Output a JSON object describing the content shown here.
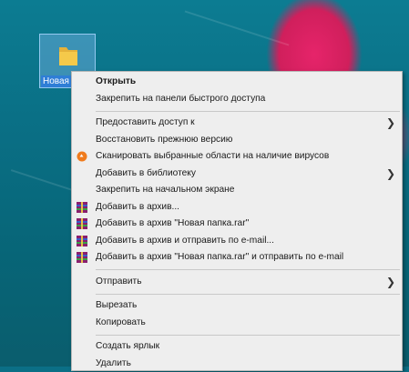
{
  "desktop": {
    "folder": {
      "label": "Новая"
    }
  },
  "context_menu": {
    "groups": [
      [
        {
          "label": "Открыть",
          "bold": true
        },
        {
          "label": "Закрепить на панели быстрого доступа"
        }
      ],
      [
        {
          "label": "Предоставить доступ к",
          "submenu": true
        },
        {
          "label": "Восстановить прежнюю версию"
        },
        {
          "label": "Сканировать выбранные области на наличие вирусов",
          "icon": "antivirus-icon"
        },
        {
          "label": "Добавить в библиотеку",
          "submenu": true
        },
        {
          "label": "Закрепить на начальном экране"
        },
        {
          "label": "Добавить в архив...",
          "icon": "winrar-icon"
        },
        {
          "label": "Добавить в архив \"Новая папка.rar\"",
          "icon": "winrar-icon"
        },
        {
          "label": "Добавить в архив и отправить по e-mail...",
          "icon": "winrar-icon"
        },
        {
          "label": "Добавить в архив \"Новая папка.rar\" и отправить по e-mail",
          "icon": "winrar-icon"
        }
      ],
      [
        {
          "label": "Отправить",
          "submenu": true
        }
      ],
      [
        {
          "label": "Вырезать"
        },
        {
          "label": "Копировать"
        }
      ],
      [
        {
          "label": "Создать ярлык"
        },
        {
          "label": "Удалить"
        }
      ]
    ]
  },
  "colors": {
    "accent": "#2f7ed6",
    "menu_bg": "#eeeeee",
    "folder_yellow": "#f5c94a",
    "antivirus_orange": "#f07b1c"
  }
}
